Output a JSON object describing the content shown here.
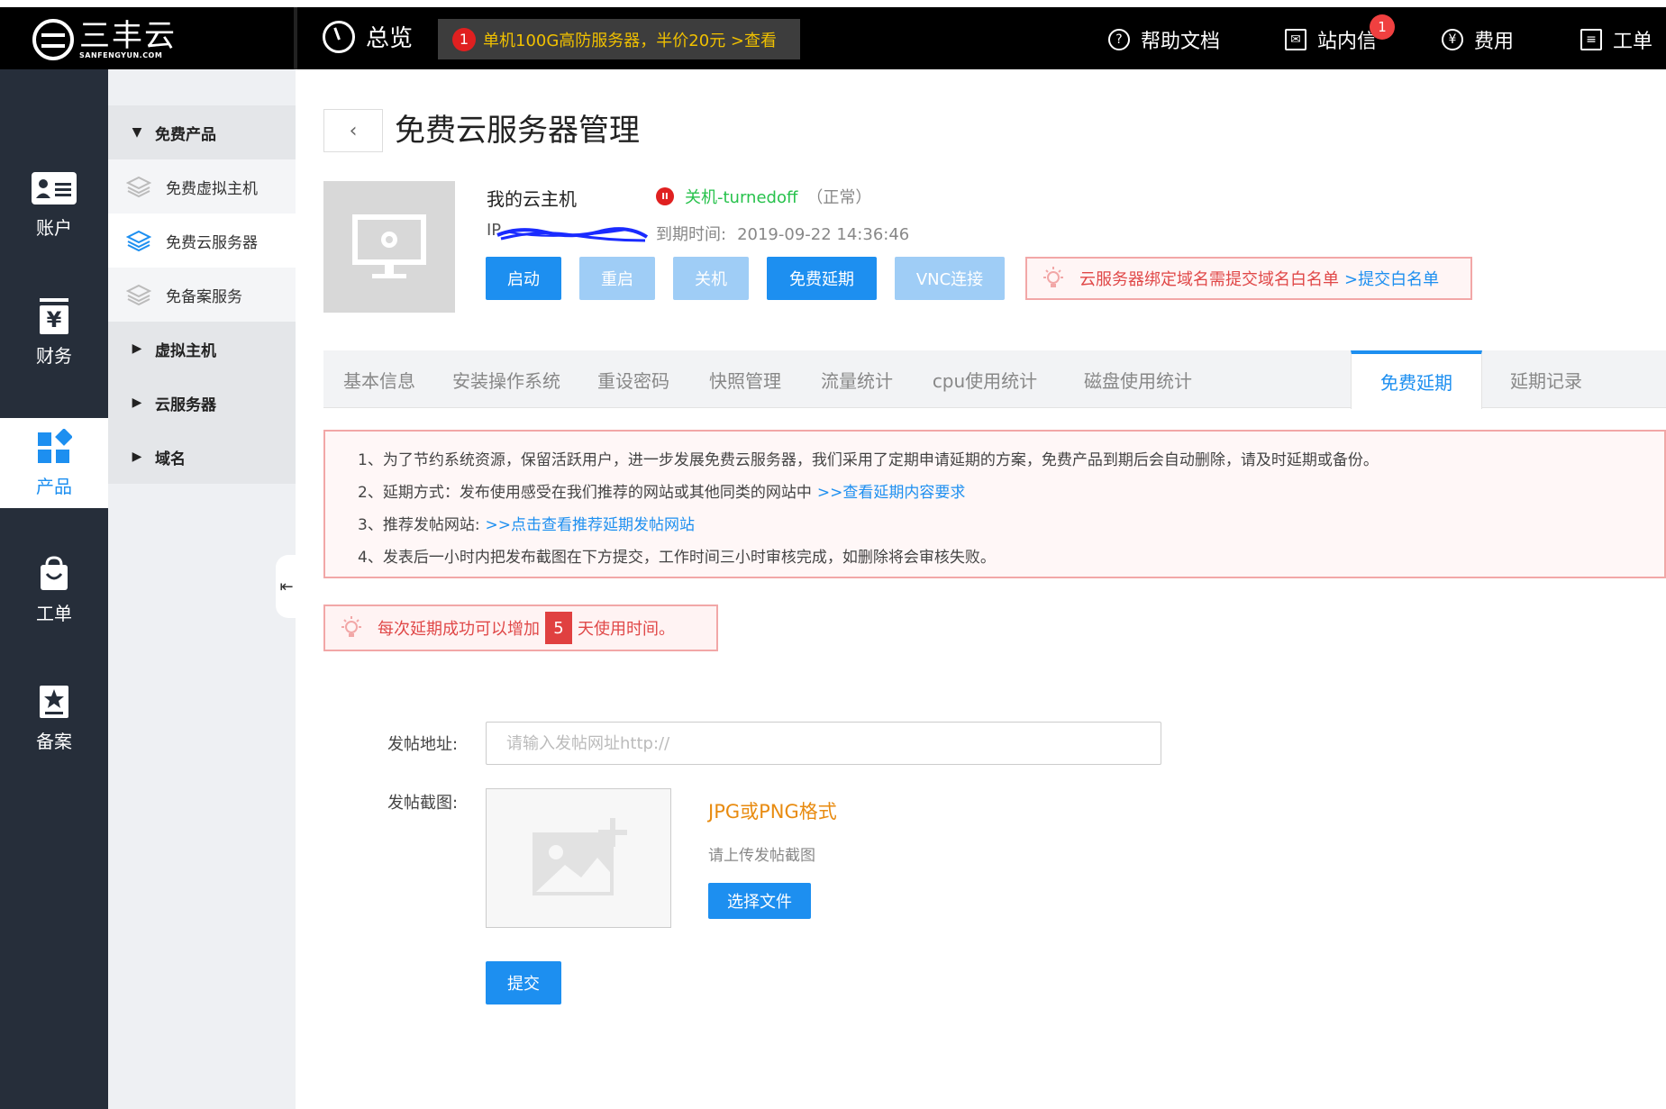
{
  "header": {
    "logo_cn": "三丰云",
    "logo_en": "SANFENGYUN.COM",
    "overview": "总览",
    "promo": {
      "num": "1",
      "text": "单机100G高防服务器，半价20元 >查看"
    },
    "nav": {
      "help": "帮助文档",
      "messages": "站内信",
      "message_count": "1",
      "billing": "费用",
      "ticket": "工单"
    }
  },
  "leftbar": {
    "items": [
      {
        "label": "账户",
        "icon": "account-icon"
      },
      {
        "label": "财务",
        "icon": "finance-icon"
      },
      {
        "label": "产品",
        "icon": "product-icon"
      },
      {
        "label": "工单",
        "icon": "ticket-icon"
      },
      {
        "label": "备案",
        "icon": "record-icon"
      }
    ],
    "active": "产品"
  },
  "subbar": {
    "group_free": "免费产品",
    "free_items": [
      "免费虚拟主机",
      "免费云服务器",
      "免备案服务"
    ],
    "active_item": "免费云服务器",
    "groups": [
      "虚拟主机",
      "云服务器",
      "域名"
    ]
  },
  "page": {
    "back": "‹",
    "title": "免费云服务器管理"
  },
  "server": {
    "name": "我的云主机",
    "status": "关机-turnedoff",
    "status_note": "（正常）",
    "ip_prefix": "IP",
    "expiry_label": "到期时间:",
    "expiry_value": "2019-09-22 14:36:46",
    "status_color": "#27c24c"
  },
  "actions": {
    "start": "启动",
    "restart": "重启",
    "shutdown": "关机",
    "extend": "免费延期",
    "vnc": "VNC连接"
  },
  "notice_top": {
    "text": "云服务器绑定域名需提交域名白名单",
    "link": ">提交白名单"
  },
  "tabs": [
    "基本信息",
    "安装操作系统",
    "重设密码",
    "快照管理",
    "流量统计",
    "cpu使用统计",
    "磁盘使用统计",
    "免费延期",
    "延期记录"
  ],
  "active_tab": "免费延期",
  "rules": {
    "r1": "1、为了节约系统资源，保留活跃用户，进一步发展免费云服务器，我们采用了定期申请延期的方案，免费产品到期后会自动删除，请及时延期或备份。",
    "r2": "2、延期方式：发布使用感受在我们推荐的网站或其他同类的网站中",
    "r2_link": ">>查看延期内容要求",
    "r3": "3、推荐发帖网站:",
    "r3_link": ">>点击查看推荐延期发帖网站",
    "r4": "4、发表后一小时内把发布截图在下方提交，工作时间三小时审核完成，如删除将会审核失败。"
  },
  "bonus": {
    "before": "每次延期成功可以增加",
    "days": "5",
    "after": "天使用时间。"
  },
  "form": {
    "url_label": "发帖地址:",
    "url_placeholder": "请输入发帖网址http://",
    "url_value": "",
    "shot_label": "发帖截图:",
    "format": "JPG或PNG格式",
    "hint": "请上传发帖截图",
    "choose": "选择文件",
    "submit": "提交"
  },
  "colors": {
    "accent": "#1d8ff0",
    "sidebar": "#262e3a",
    "warning_text": "#e04848",
    "format_text": "#e88b10"
  }
}
